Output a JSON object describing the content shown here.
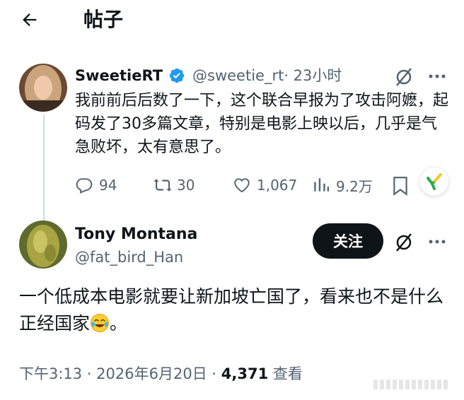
{
  "header": {
    "title": "帖子"
  },
  "parent_tweet": {
    "name": "SweetieRT",
    "handle": "@sweetie_rt",
    "time": "· 23小时",
    "text": "我前前后后数了一下，这个联合早报为了攻击阿嬷，起码发了30多篇文章，特别是电影上映以后，几乎是气急败坏，太有意思了。",
    "replies": "94",
    "retweets": "30",
    "likes": "1,067",
    "views": "9.2万"
  },
  "main_tweet": {
    "name": "Tony Montana",
    "handle": "@fat_bird_Han",
    "follow_label": "关注",
    "text": "一个低成本电影就要让新加坡亡国了，看来也不是什么正经国家",
    "text_suffix": "。",
    "emoji": "face-with-tears-of-joy",
    "time": "下午3:13 · 2026年6月20日 · ",
    "views": "4,371",
    "views_label": " 查看"
  },
  "colors": {
    "text": "#0f1419",
    "muted": "#536471",
    "verified": "#1d9bf0",
    "thread_line": "#cfd9de"
  }
}
